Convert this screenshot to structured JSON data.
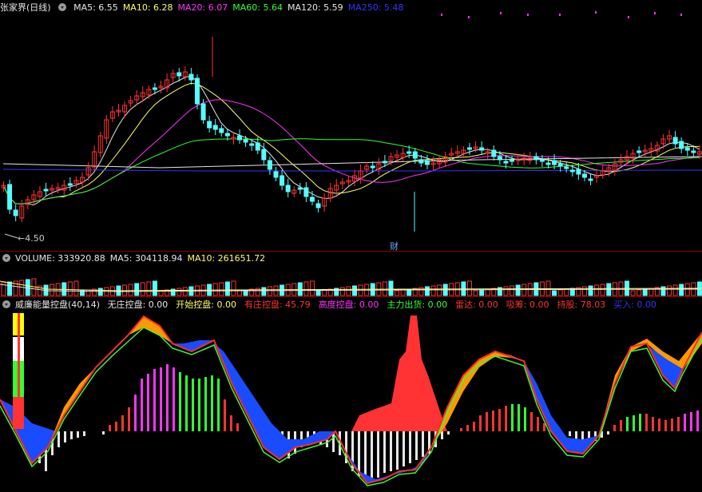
{
  "header": {
    "stock": "张家界",
    "period": "(日线)",
    "ma": [
      {
        "label": "MA5: 6.55",
        "color": "#e6e6e6"
      },
      {
        "label": "MA10: 6.28",
        "color": "#ffff66"
      },
      {
        "label": "MA20: 6.07",
        "color": "#ff33ff"
      },
      {
        "label": "MA60: 5.64",
        "color": "#33ff33"
      },
      {
        "label": "MA120: 5.59",
        "color": "#e6e6e6"
      },
      {
        "label": "MA250: 5.48",
        "color": "#3333ff"
      }
    ]
  },
  "price_panel": {
    "low_label": "4.50",
    "event_label": "财"
  },
  "volume": {
    "title": "VOLUME: 333920.88",
    "ma5": "MA5: 304118.94",
    "ma10": "MA10: 261651.72"
  },
  "indicator": {
    "title": "威廉能量控盘(40,14)",
    "items": [
      {
        "label": "无庄控盘: 0.00",
        "color": "#e6e6e6"
      },
      {
        "label": "开始控盘: 0.00",
        "color": "#ffff66"
      },
      {
        "label": "有庄控盘: 45.79",
        "color": "#ff3333"
      },
      {
        "label": "高度控盘: 0.00",
        "color": "#ff33ff"
      },
      {
        "label": "主力出货: 0.00",
        "color": "#33ff33"
      },
      {
        "label": "雷达: 0.00",
        "color": "#ff3333"
      },
      {
        "label": "吸筹: 0.00",
        "color": "#ff3333"
      },
      {
        "label": "持股: 78.03",
        "color": "#ff3333"
      },
      {
        "label": "买入: 0.00",
        "color": "#3333ff"
      }
    ]
  },
  "colors": {
    "up": "#ff3333",
    "down": "#54ffff",
    "divider": "#8b0000"
  }
}
